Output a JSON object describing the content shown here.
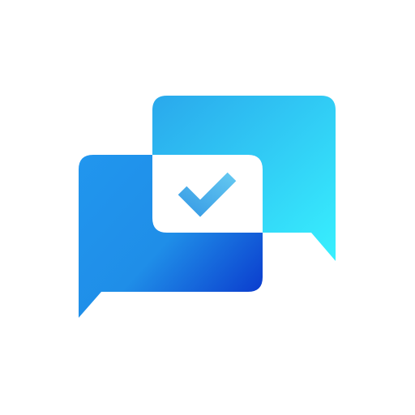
{
  "app": {
    "icon": "chat-bubbles-check-icon"
  },
  "colors": {
    "background": "#ffffff",
    "back_bubble_start": "#2aa8ec",
    "back_bubble_end": "#38f0fe",
    "front_bubble_start": "#2196ee",
    "front_bubble_end": "#0c40cf",
    "center_card": "#ffffff",
    "checkmark_start": "#3a9ee6",
    "checkmark_end": "#62c6f0"
  }
}
